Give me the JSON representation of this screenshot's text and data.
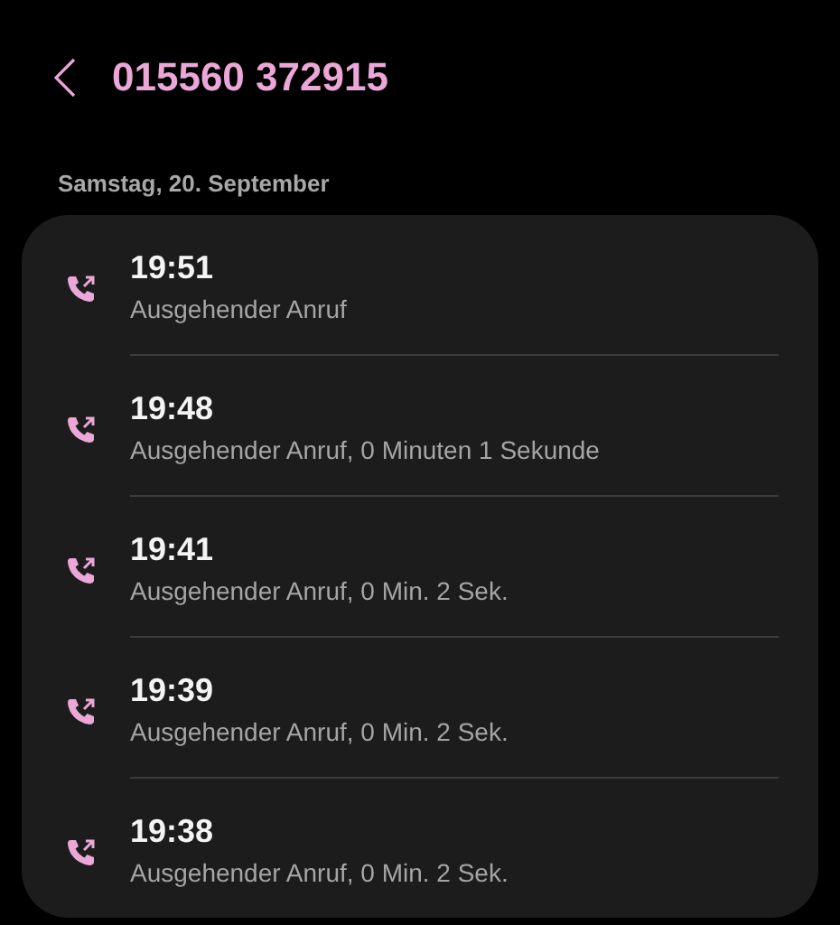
{
  "header": {
    "title": "015560 372915"
  },
  "date_header": "Samstag, 20. September",
  "calls": [
    {
      "kind": "outgoing",
      "time": "19:51",
      "detail": "Ausgehender Anruf"
    },
    {
      "kind": "outgoing",
      "time": "19:48",
      "detail": "Ausgehender Anruf, 0 Minuten 1 Sekunde"
    },
    {
      "kind": "outgoing",
      "time": "19:41",
      "detail": "Ausgehender Anruf, 0 Min. 2 Sek."
    },
    {
      "kind": "outgoing",
      "time": "19:39",
      "detail": "Ausgehender Anruf, 0 Min. 2 Sek."
    },
    {
      "kind": "outgoing",
      "time": "19:38",
      "detail": "Ausgehender Anruf, 0 Min. 2 Sek."
    }
  ]
}
